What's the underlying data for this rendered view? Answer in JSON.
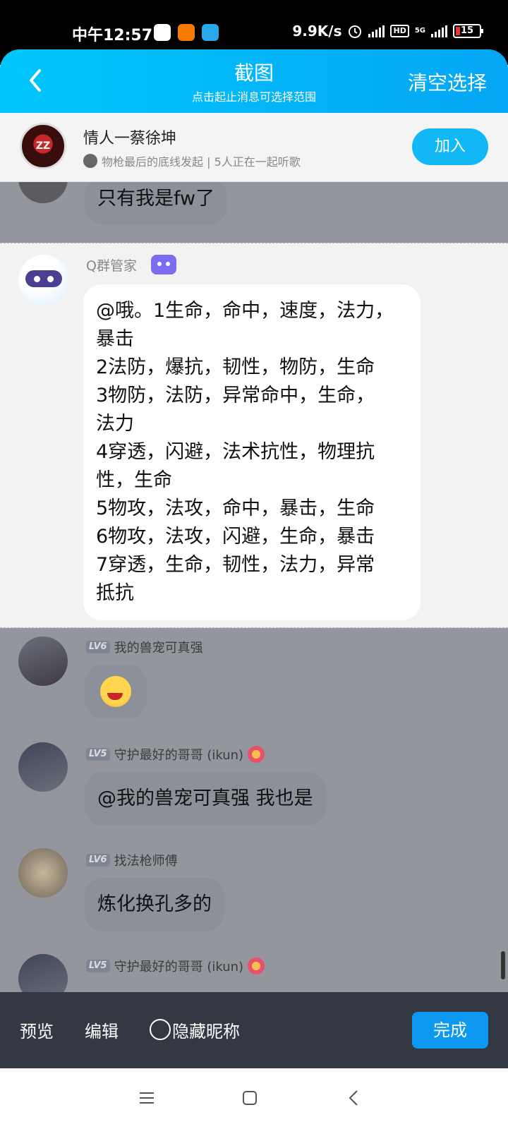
{
  "status_bar": {
    "time": "中午12:57",
    "speed": "9.9K/s",
    "hd": "HD",
    "network": "5G",
    "battery": "15"
  },
  "header": {
    "title": "截图",
    "subtitle": "点击起止消息可选择范围",
    "clear_label": "清空选择",
    "back_icon": "chevron-left-icon"
  },
  "music": {
    "title": "情人一蔡徐坤",
    "subtitle": "物枪最后的底线发起 | 5人正在一起听歌",
    "join_label": "加入"
  },
  "messages": {
    "top_partial": "只有我是fw了",
    "bot": {
      "sender": "Q群管家",
      "lines": [
        "@哦。1生命，命中，速度，法力，",
        "暴击",
        "2法防，爆抗，韧性，物防，生命",
        "3物防，法防，异常命中，生命，",
        "法力",
        "4穿透，闪避，法术抗性，物理抗",
        "性，生命",
        "5物攻，法攻，命中，暴击，生命",
        "6物攻，法攻，闪避，生命，暴击",
        "7穿透，生命，韧性，法力，异常",
        "抵抗"
      ]
    },
    "m1": {
      "level": "LV6",
      "sender": "我的兽宠可真强"
    },
    "m2": {
      "level": "LV5",
      "sender": "守护最好的哥哥 (ikun)",
      "text": "@我的兽宠可真强 我也是"
    },
    "m3": {
      "level": "LV6",
      "sender": "找法枪师傅",
      "text": "炼化换孔多的"
    },
    "m4": {
      "level": "LV5",
      "sender": "守护最好的哥哥 (ikun)"
    }
  },
  "toolbar": {
    "preview": "预览",
    "edit": "编辑",
    "hide_nick": "隐藏昵称",
    "done": "完成"
  },
  "colors": {
    "header_accent": "#05a6f5",
    "join_button": "#12b7f5",
    "done_button": "#0d99f2",
    "toolbar_bg": "#333842",
    "dim_overlay": "#93969d"
  }
}
